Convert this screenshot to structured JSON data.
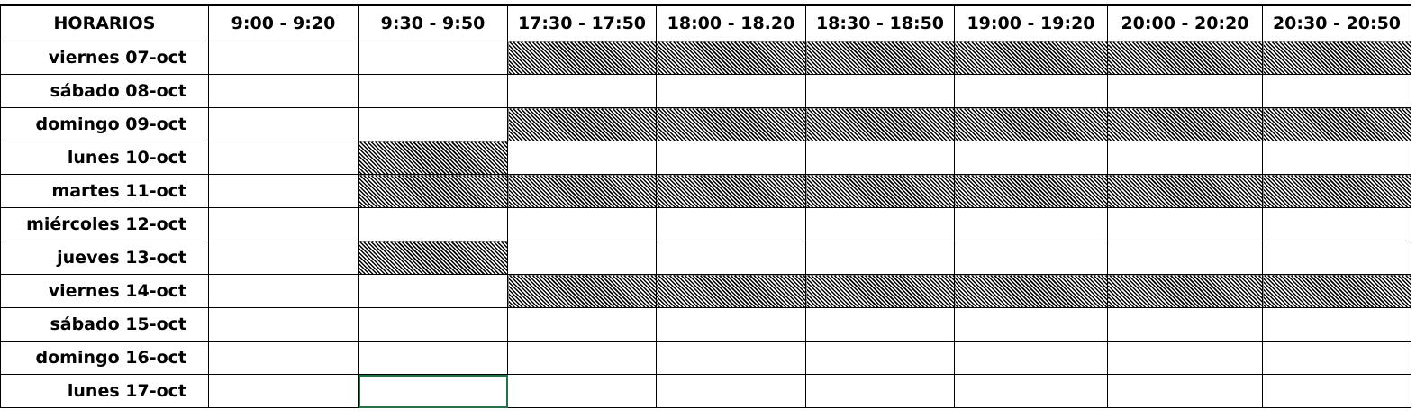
{
  "header": {
    "corner": "HORARIOS",
    "slots": [
      "9:00 - 9:20",
      "9:30 - 9:50",
      "17:30 - 17:50",
      "18:00 - 18.20",
      "18:30 - 18:50",
      "19:00 - 19:20",
      "20:00 - 20:20",
      "20:30 - 20:50"
    ]
  },
  "rows": [
    {
      "label": "viernes 07-oct",
      "blocked": [
        0,
        0,
        1,
        1,
        1,
        1,
        1,
        1
      ]
    },
    {
      "label": "sábado 08-oct",
      "blocked": [
        0,
        0,
        0,
        0,
        0,
        0,
        0,
        0
      ]
    },
    {
      "label": "domingo 09-oct",
      "blocked": [
        0,
        0,
        1,
        1,
        1,
        1,
        1,
        1
      ]
    },
    {
      "label": "lunes 10-oct",
      "blocked": [
        0,
        1,
        0,
        0,
        0,
        0,
        0,
        0
      ]
    },
    {
      "label": "martes 11-oct",
      "blocked": [
        0,
        1,
        1,
        1,
        1,
        1,
        1,
        1
      ]
    },
    {
      "label": "miércoles 12-oct",
      "blocked": [
        0,
        0,
        0,
        0,
        0,
        0,
        0,
        0
      ]
    },
    {
      "label": "jueves 13-oct",
      "blocked": [
        0,
        1,
        0,
        0,
        0,
        0,
        0,
        0
      ]
    },
    {
      "label": "viernes 14-oct",
      "blocked": [
        0,
        0,
        1,
        1,
        1,
        1,
        1,
        1
      ]
    },
    {
      "label": "sábado 15-oct",
      "blocked": [
        0,
        0,
        0,
        0,
        0,
        0,
        0,
        0
      ]
    },
    {
      "label": "domingo 16-oct",
      "blocked": [
        0,
        0,
        0,
        0,
        0,
        0,
        0,
        0
      ]
    },
    {
      "label": "lunes 17-oct",
      "blocked": [
        0,
        0,
        0,
        0,
        0,
        0,
        0,
        0
      ]
    }
  ],
  "selected_cell": {
    "row": 10,
    "col": 1
  },
  "colors": {
    "selection": "#217346",
    "hatch": "#000000"
  }
}
